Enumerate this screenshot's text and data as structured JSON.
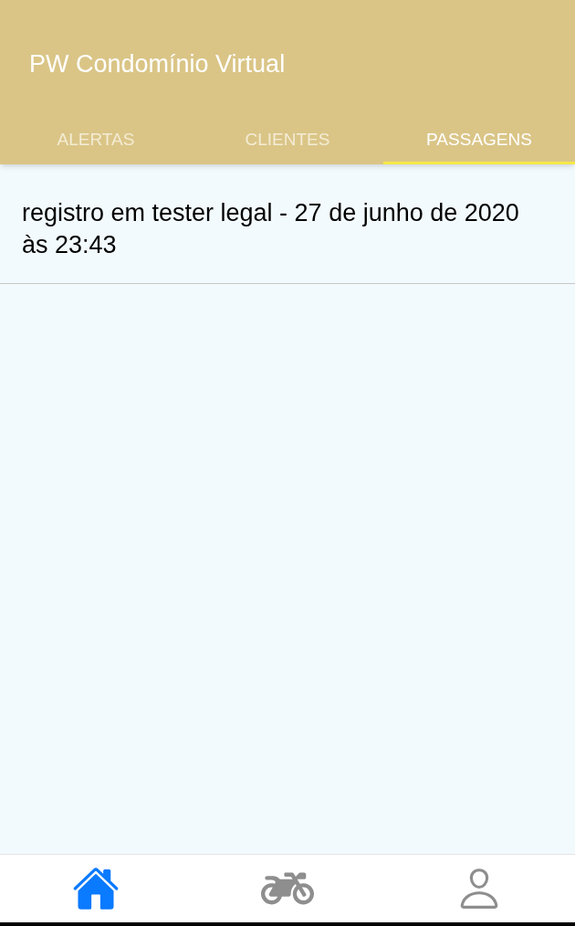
{
  "app_bar": {
    "title": "PW Condomínio Virtual"
  },
  "tabs": [
    {
      "label": "ALERTAS",
      "selected": false
    },
    {
      "label": "CLIENTES",
      "selected": false
    },
    {
      "label": "PASSAGENS",
      "selected": true
    }
  ],
  "entries": [
    "registro em tester legal - 27 de junho de 2020 às 23:43"
  ],
  "bottom_nav": [
    {
      "kind": "home",
      "selected": true
    },
    {
      "kind": "motorcycle",
      "selected": false
    },
    {
      "kind": "profile",
      "selected": false
    }
  ]
}
